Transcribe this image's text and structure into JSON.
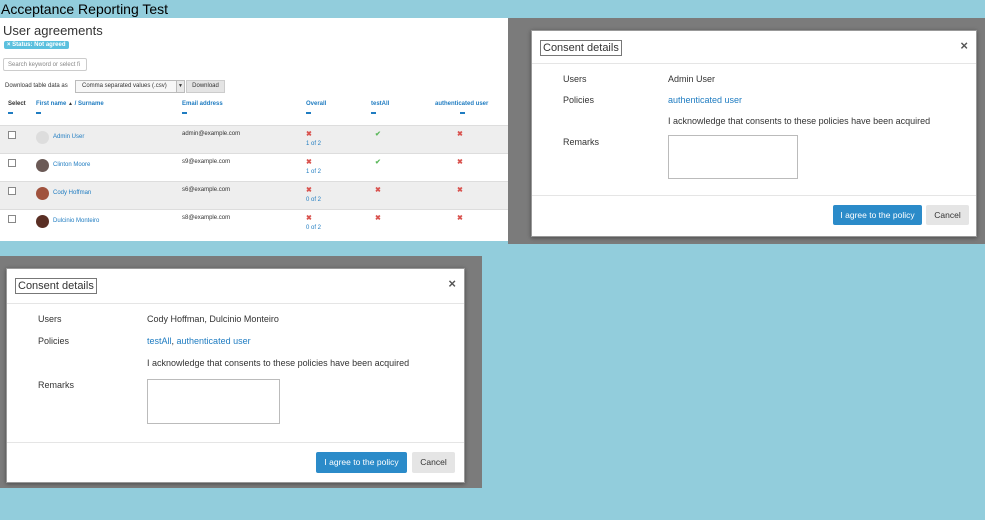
{
  "doc_title": "Acceptance Reporting Test",
  "agreements": {
    "title": "User agreements",
    "filter_badge": "× Status: Not agreed",
    "search_placeholder": "Search keyword or select fi",
    "download_label": "Download table data as",
    "download_format": "Comma separated values (.csv)",
    "download_button": "Download",
    "columns": {
      "select": "Select",
      "first_name": "First name",
      "surname": "/ Surname",
      "email": "Email address",
      "overall": "Overall",
      "testall": "testAll",
      "authenticated": "authenticated user"
    },
    "rows": [
      {
        "name": "Admin User",
        "email": "admin@example.com",
        "overall_count": "1 of 2",
        "testall": "check",
        "auth": "x"
      },
      {
        "name": "Clinton Moore",
        "email": "s9@example.com",
        "overall_count": "1 of 2",
        "testall": "check",
        "auth": "x"
      },
      {
        "name": "Cody Hoffman",
        "email": "s6@example.com",
        "overall_count": "0 of 2",
        "testall": "x",
        "auth": "x"
      },
      {
        "name": "Dulcinio Monteiro",
        "email": "s8@example.com",
        "overall_count": "0 of 2",
        "testall": "x",
        "auth": "x"
      }
    ],
    "symbols": {
      "x": "✖",
      "check": "✔"
    }
  },
  "modal_a": {
    "title": "Consent details",
    "close": "×",
    "users_label": "Users",
    "users_value": "Admin User",
    "policies_label": "Policies",
    "policy_1": "authenticated user",
    "acknowledge": "I acknowledge that consents to these policies have been acquired",
    "remarks_label": "Remarks",
    "agree_button": "I agree to the policy",
    "cancel_button": "Cancel"
  },
  "modal_b": {
    "title": "Consent details",
    "close": "×",
    "users_label": "Users",
    "users_value": "Cody Hoffman, Dulcinio Monteiro",
    "policies_label": "Policies",
    "policy_1": "testAll",
    "policy_sep": ", ",
    "policy_2": "authenticated user",
    "acknowledge": "I acknowledge that consents to these policies have been acquired",
    "remarks_label": "Remarks",
    "agree_button": "I agree to the policy",
    "cancel_button": "Cancel"
  },
  "colors": {
    "background": "#92cddc",
    "accent": "#1f7cc1",
    "primary_button": "#2b8bc9",
    "danger": "#d9534f",
    "success": "#5cb85c"
  }
}
